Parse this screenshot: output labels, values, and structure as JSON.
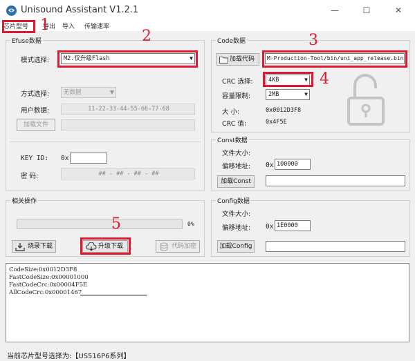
{
  "window": {
    "title": "Unisound Assistant V1.2.1",
    "minimize": "—",
    "maximize": "☐",
    "close": "✕"
  },
  "menu": [
    "芯片型号",
    "导出",
    "导入",
    "传输速率"
  ],
  "efuse": {
    "title": "Efuse数据",
    "mode_label": "模式选择:",
    "mode_value": "M2.仅升级Flash",
    "method_label": "方式选择:",
    "method_value": "无数据",
    "user_label": "用户数据:",
    "user_value": "11-22-33-44-55-66-77-68",
    "load_file": "加载文件",
    "key_label": "KEY  ID:",
    "key_prefix": "0x",
    "password_label": "密    码:",
    "password_value": "## - ## - ## - ##"
  },
  "code": {
    "title": "Code数据",
    "load_button": "加载代码",
    "path": "M-Production-Tool/bin/uni_app_release.bin",
    "crc_label": "CRC 选择:",
    "crc_value": "4KB",
    "capacity_label": "容量限制:",
    "capacity_value": "2MB",
    "size_label": "大    小:",
    "size_value": "0x0012D3F8",
    "crc_val_label": "CRC   值:",
    "crc_val_value": "0x4F5E"
  },
  "const": {
    "title": "Const数据",
    "file_size_label": "文件大小:",
    "offset_label": "偏移地址:",
    "offset_prefix": "0x",
    "offset_value": "100000",
    "load_button": "加载Const"
  },
  "config": {
    "title": "Config数据",
    "file_size_label": "文件大小:",
    "offset_label": "偏移地址:",
    "offset_prefix": "0x",
    "offset_value": "1E0000",
    "load_button": "加载Config"
  },
  "ops": {
    "title": "相关操作",
    "progress_percent": 0,
    "progress_label": "0%",
    "burn_button": "烧录下载",
    "upgrade_button": "升级下载",
    "encrypt_button": "代码加密"
  },
  "log": [
    "CodeSize:0x0012D3F8",
    "FastCodeSize:0x00001000",
    "FastCodeCrc:0x00004F5E",
    "AllCodeCrc:0x00001467"
  ],
  "status": "当前芯片型号选择为:【US516P6系列】",
  "annotations": [
    "1",
    "2",
    "3",
    "4",
    "5"
  ],
  "colors": {
    "highlight": "#e01830"
  }
}
